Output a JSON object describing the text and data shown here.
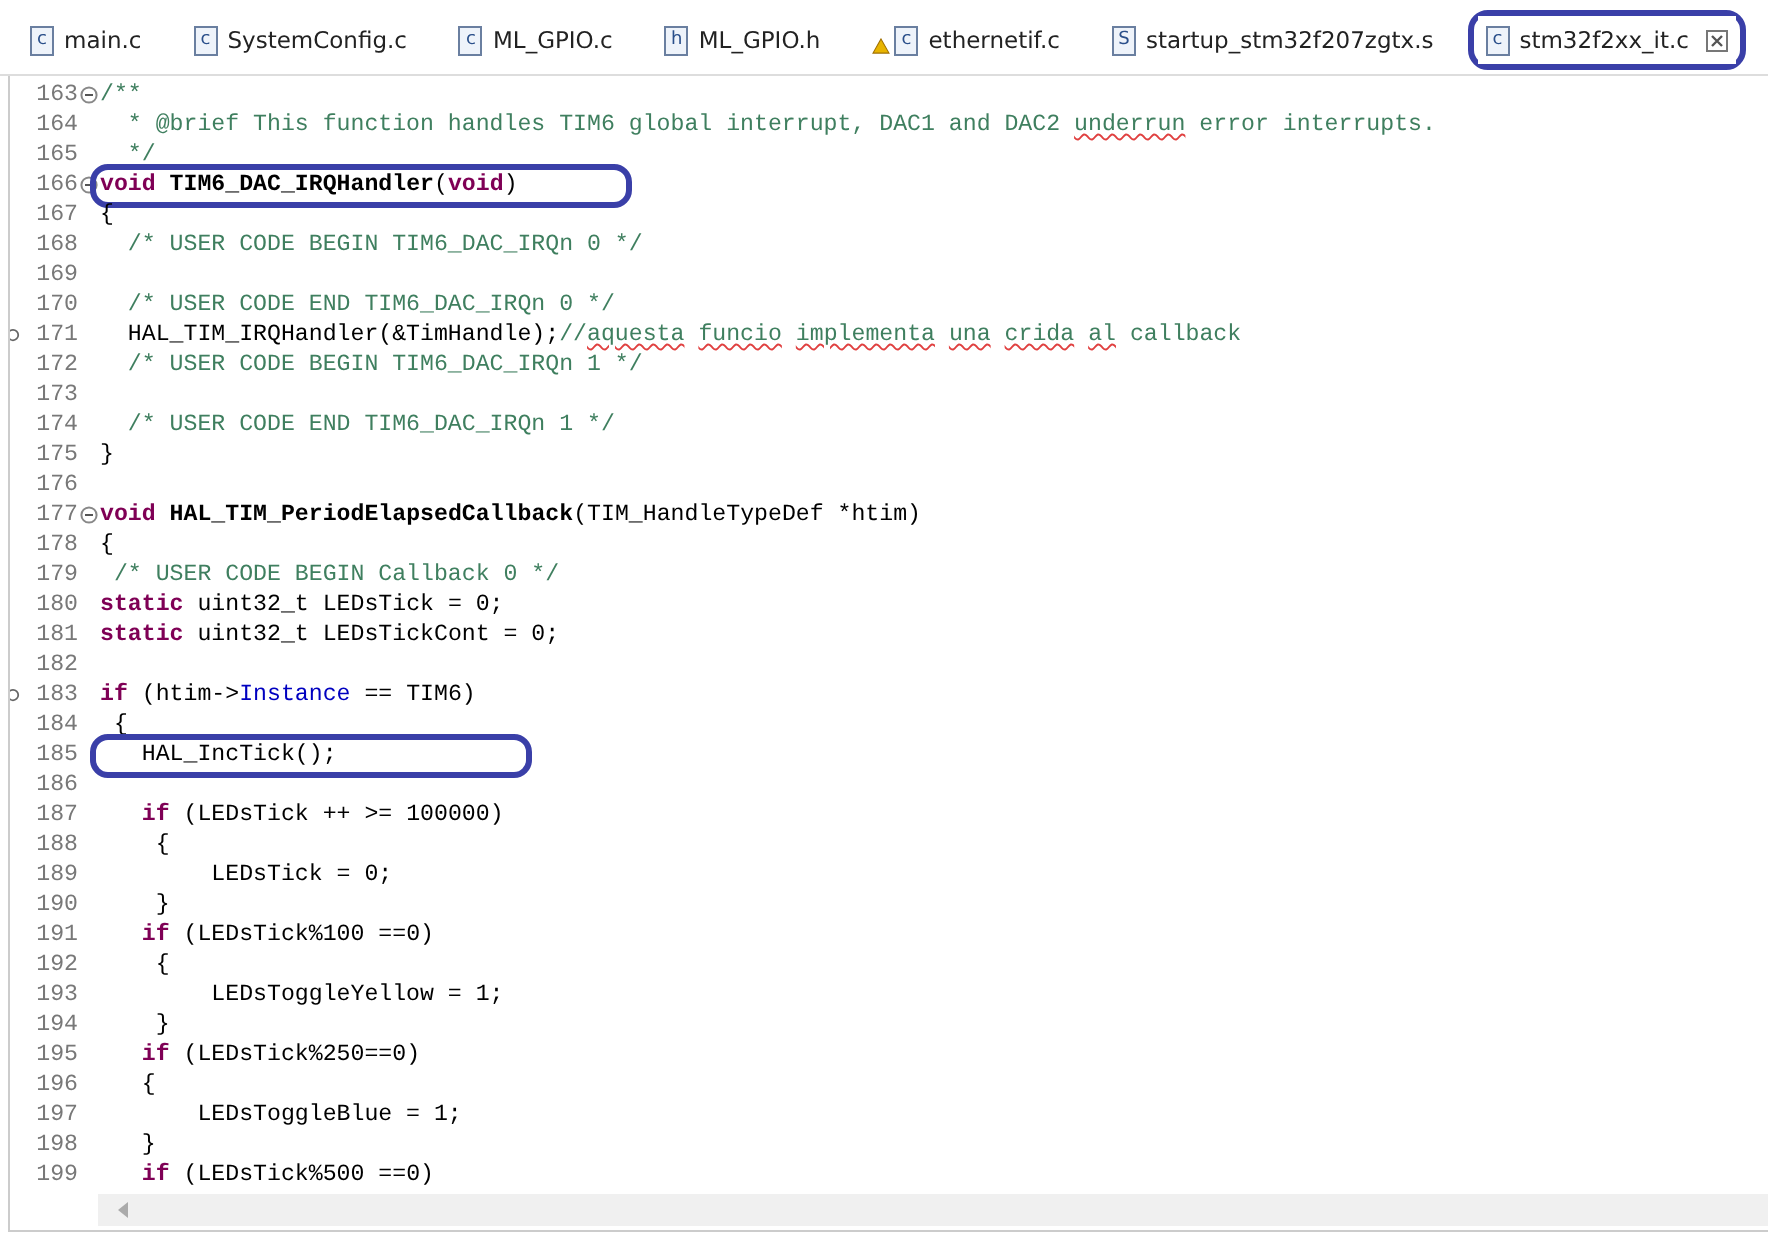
{
  "tabs": [
    {
      "label": "main.c",
      "badge": "c",
      "warning": false,
      "selected": false,
      "circled": false
    },
    {
      "label": "SystemConfig.c",
      "badge": "c",
      "warning": false,
      "selected": false,
      "circled": false
    },
    {
      "label": "ML_GPIO.c",
      "badge": "c",
      "warning": false,
      "selected": false,
      "circled": false
    },
    {
      "label": "ML_GPIO.h",
      "badge": "h",
      "warning": false,
      "selected": false,
      "circled": false
    },
    {
      "label": "ethernetif.c",
      "badge": "c",
      "warning": true,
      "selected": false,
      "circled": false
    },
    {
      "label": "startup_stm32f207zgtx.s",
      "badge": "S",
      "warning": false,
      "selected": false,
      "circled": false
    },
    {
      "label": "stm32f2xx_it.c",
      "badge": "c",
      "warning": false,
      "selected": true,
      "circled": true
    }
  ],
  "lines": [
    {
      "n": "163",
      "fold": true,
      "mark": false,
      "circled": false,
      "tokens": [
        {
          "kind": "comment",
          "t": "/**"
        }
      ]
    },
    {
      "n": "164",
      "fold": false,
      "mark": false,
      "circled": false,
      "tokens": [
        {
          "kind": "comment",
          "t": "  * @brief This function handles TIM6 global interrupt, DAC1 and DAC2"
        },
        {
          "kind": "spell",
          "t": " underrun"
        },
        {
          "kind": "comment",
          "t": " error interrupts."
        }
      ]
    },
    {
      "n": "165",
      "fold": false,
      "mark": false,
      "circled": false,
      "tokens": [
        {
          "kind": "comment",
          "t": "  */"
        }
      ]
    },
    {
      "n": "166",
      "fold": true,
      "mark": false,
      "circled": true,
      "tokens": [
        {
          "kind": "keyword",
          "t": "void"
        },
        {
          "kind": "function",
          "t": " TIM6_DAC_IRQHandler"
        },
        {
          "kind": "plain",
          "t": "("
        },
        {
          "kind": "keyword",
          "t": "void"
        },
        {
          "kind": "plain",
          "t": ")"
        }
      ]
    },
    {
      "n": "167",
      "fold": false,
      "mark": false,
      "circled": false,
      "tokens": [
        {
          "kind": "plain",
          "t": "{"
        }
      ]
    },
    {
      "n": "168",
      "fold": false,
      "mark": false,
      "circled": false,
      "tokens": [
        {
          "kind": "comment",
          "t": "  /* USER CODE BEGIN TIM6_DAC_IRQn 0 */"
        }
      ]
    },
    {
      "n": "169",
      "fold": false,
      "mark": false,
      "circled": false
    },
    {
      "n": "170",
      "fold": false,
      "mark": false,
      "circled": false,
      "tokens": [
        {
          "kind": "comment",
          "t": "  /* USER CODE END TIM6_DAC_IRQn 0 */"
        }
      ]
    },
    {
      "n": "171",
      "fold": false,
      "mark": true,
      "circled": false,
      "tokens": [
        {
          "kind": "plain",
          "t": "  HAL_TIM_IRQHandler(&TimHandle);"
        },
        {
          "kind": "comment",
          "t": "//"
        },
        {
          "kind": "spell",
          "t": "aquesta"
        },
        {
          "kind": "spell",
          "t": " funcio"
        },
        {
          "kind": "spell",
          "t": " implementa"
        },
        {
          "kind": "spell",
          "t": " una"
        },
        {
          "kind": "spell",
          "t": " crida"
        },
        {
          "kind": "spell",
          "t": " al"
        },
        {
          "kind": "comment",
          "t": " callback"
        }
      ]
    },
    {
      "n": "172",
      "fold": false,
      "mark": false,
      "circled": false,
      "tokens": [
        {
          "kind": "comment",
          "t": "  /* USER CODE BEGIN TIM6_DAC_IRQn 1 */"
        }
      ]
    },
    {
      "n": "173",
      "fold": false,
      "mark": false,
      "circled": false
    },
    {
      "n": "174",
      "fold": false,
      "mark": false,
      "circled": false,
      "tokens": [
        {
          "kind": "comment",
          "t": "  /* USER CODE END TIM6_DAC_IRQn 1 */"
        }
      ]
    },
    {
      "n": "175",
      "fold": false,
      "mark": false,
      "circled": false,
      "tokens": [
        {
          "kind": "plain",
          "t": "}"
        }
      ]
    },
    {
      "n": "176",
      "fold": false,
      "mark": false,
      "circled": false
    },
    {
      "n": "177",
      "fold": true,
      "mark": false,
      "circled": false,
      "tokens": [
        {
          "kind": "keyword",
          "t": "void"
        },
        {
          "kind": "function",
          "t": " HAL_TIM_PeriodElapsedCallback"
        },
        {
          "kind": "plain",
          "t": "(TIM_HandleTypeDef *htim)"
        }
      ]
    },
    {
      "n": "178",
      "fold": false,
      "mark": false,
      "circled": false,
      "tokens": [
        {
          "kind": "plain",
          "t": "{"
        }
      ]
    },
    {
      "n": "179",
      "fold": false,
      "mark": false,
      "circled": false,
      "tokens": [
        {
          "kind": "comment",
          "t": " /* USER CODE BEGIN Callback 0 */"
        }
      ]
    },
    {
      "n": "180",
      "fold": false,
      "mark": false,
      "circled": false,
      "tokens": [
        {
          "kind": "keyword",
          "t": "static"
        },
        {
          "kind": "plain",
          "t": " uint32_t LEDsTick = 0;"
        }
      ]
    },
    {
      "n": "181",
      "fold": false,
      "mark": false,
      "circled": false,
      "tokens": [
        {
          "kind": "keyword",
          "t": "static"
        },
        {
          "kind": "plain",
          "t": " uint32_t LEDsTickCont = 0;"
        }
      ]
    },
    {
      "n": "182",
      "fold": false,
      "mark": false,
      "circled": false
    },
    {
      "n": "183",
      "fold": false,
      "mark": true,
      "circled": false,
      "tokens": [
        {
          "kind": "keyword",
          "t": "if"
        },
        {
          "kind": "plain",
          "t": " (htim->"
        },
        {
          "kind": "field",
          "t": "Instance"
        },
        {
          "kind": "plain",
          "t": " == TIM6)"
        }
      ]
    },
    {
      "n": "184",
      "fold": false,
      "mark": false,
      "circled": false,
      "tokens": [
        {
          "kind": "plain",
          "t": " {"
        }
      ]
    },
    {
      "n": "185",
      "fold": false,
      "mark": false,
      "circled": true,
      "tokens": [
        {
          "kind": "plain",
          "t": "   HAL_IncTick();"
        }
      ]
    },
    {
      "n": "186",
      "fold": false,
      "mark": false,
      "circled": false
    },
    {
      "n": "187",
      "fold": false,
      "mark": false,
      "circled": false,
      "tokens": [
        {
          "kind": "keyword",
          "t": "   if"
        },
        {
          "kind": "plain",
          "t": " (LEDsTick ++ >= 100000)"
        }
      ]
    },
    {
      "n": "188",
      "fold": false,
      "mark": false,
      "circled": false,
      "tokens": [
        {
          "kind": "plain",
          "t": "    {"
        }
      ]
    },
    {
      "n": "189",
      "fold": false,
      "mark": false,
      "circled": false,
      "tokens": [
        {
          "kind": "plain",
          "t": "        LEDsTick = 0;"
        }
      ]
    },
    {
      "n": "190",
      "fold": false,
      "mark": false,
      "circled": false,
      "tokens": [
        {
          "kind": "plain",
          "t": "    }"
        }
      ]
    },
    {
      "n": "191",
      "fold": false,
      "mark": false,
      "circled": false,
      "tokens": [
        {
          "kind": "keyword",
          "t": "   if"
        },
        {
          "kind": "plain",
          "t": " (LEDsTick%100 ==0)"
        }
      ]
    },
    {
      "n": "192",
      "fold": false,
      "mark": false,
      "circled": false,
      "tokens": [
        {
          "kind": "plain",
          "t": "    {"
        }
      ]
    },
    {
      "n": "193",
      "fold": false,
      "mark": false,
      "circled": false,
      "tokens": [
        {
          "kind": "plain",
          "t": "        LEDsToggleYellow = 1;"
        }
      ]
    },
    {
      "n": "194",
      "fold": false,
      "mark": false,
      "circled": false,
      "tokens": [
        {
          "kind": "plain",
          "t": "    }"
        }
      ]
    },
    {
      "n": "195",
      "fold": false,
      "mark": false,
      "circled": false,
      "tokens": [
        {
          "kind": "keyword",
          "t": "   if"
        },
        {
          "kind": "plain",
          "t": " (LEDsTick%250==0)"
        }
      ]
    },
    {
      "n": "196",
      "fold": false,
      "mark": false,
      "circled": false,
      "tokens": [
        {
          "kind": "plain",
          "t": "   {"
        }
      ]
    },
    {
      "n": "197",
      "fold": false,
      "mark": false,
      "circled": false,
      "tokens": [
        {
          "kind": "plain",
          "t": "       LEDsToggleBlue = 1;"
        }
      ]
    },
    {
      "n": "198",
      "fold": false,
      "mark": false,
      "circled": false,
      "tokens": [
        {
          "kind": "plain",
          "t": "   }"
        }
      ]
    },
    {
      "n": "199",
      "fold": false,
      "mark": false,
      "circled": false,
      "tokens": [
        {
          "kind": "keyword",
          "t": "   if"
        },
        {
          "kind": "plain",
          "t": " (LEDsTick%500 ==0)"
        }
      ]
    }
  ]
}
